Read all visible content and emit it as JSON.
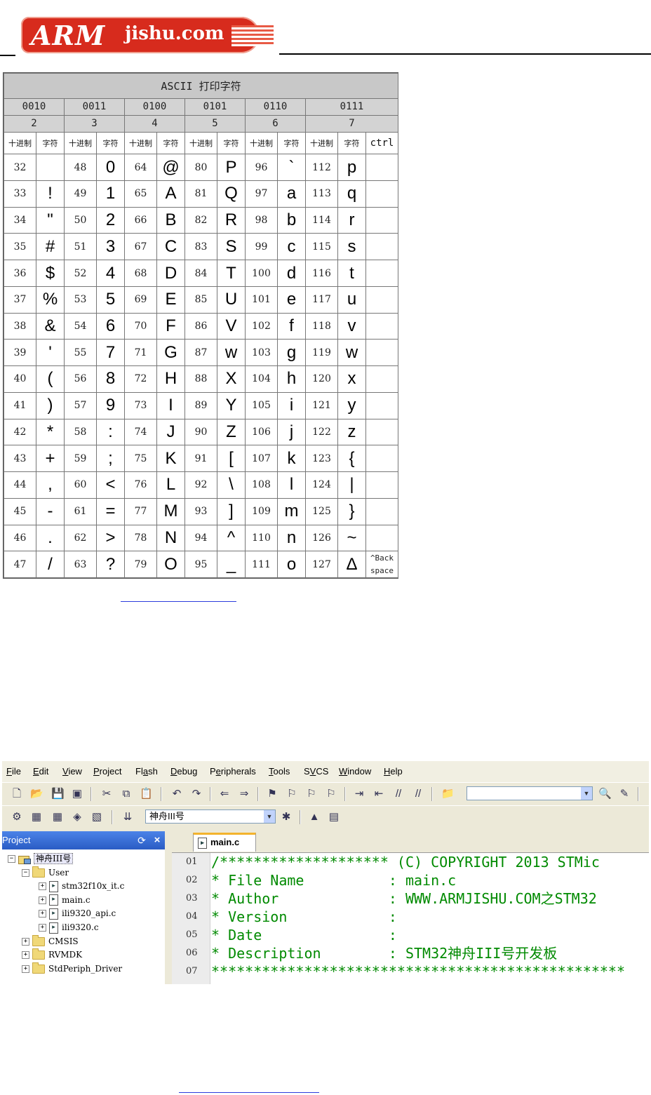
{
  "header": {
    "logo_main": "ARM",
    "logo_site": "jishu.com"
  },
  "ascii_table": {
    "title": "ASCII 打印字符",
    "binary_groups": [
      "0010",
      "0011",
      "0100",
      "0101",
      "0110",
      "0111"
    ],
    "hex_groups": [
      "2",
      "3",
      "4",
      "5",
      "6",
      "7"
    ],
    "col_dec_label": "十进制",
    "col_char_label": "字符",
    "ctrl_label": "ctrl",
    "rows": [
      {
        "d": [
          32,
          48,
          64,
          80,
          96,
          112
        ],
        "c": [
          " ",
          "0",
          "@",
          "P",
          "`",
          "p"
        ],
        "ctrl": ""
      },
      {
        "d": [
          33,
          49,
          65,
          81,
          97,
          113
        ],
        "c": [
          "!",
          "1",
          "A",
          "Q",
          "a",
          "q"
        ],
        "ctrl": ""
      },
      {
        "d": [
          34,
          50,
          66,
          82,
          98,
          114
        ],
        "c": [
          "\"",
          "2",
          "B",
          "R",
          "b",
          "r"
        ],
        "ctrl": ""
      },
      {
        "d": [
          35,
          51,
          67,
          83,
          99,
          115
        ],
        "c": [
          "#",
          "3",
          "C",
          "S",
          "c",
          "s"
        ],
        "ctrl": ""
      },
      {
        "d": [
          36,
          52,
          68,
          84,
          100,
          116
        ],
        "c": [
          "$",
          "4",
          "D",
          "T",
          "d",
          "t"
        ],
        "ctrl": ""
      },
      {
        "d": [
          37,
          53,
          69,
          85,
          101,
          117
        ],
        "c": [
          "%",
          "5",
          "E",
          "U",
          "e",
          "u"
        ],
        "ctrl": ""
      },
      {
        "d": [
          38,
          54,
          70,
          86,
          102,
          118
        ],
        "c": [
          "&",
          "6",
          "F",
          "V",
          "f",
          "v"
        ],
        "ctrl": ""
      },
      {
        "d": [
          39,
          55,
          71,
          87,
          103,
          119
        ],
        "c": [
          "'",
          "7",
          "G",
          "w",
          "g",
          "w"
        ],
        "ctrl": ""
      },
      {
        "d": [
          40,
          56,
          72,
          88,
          104,
          120
        ],
        "c": [
          "(",
          "8",
          "H",
          "X",
          "h",
          "x"
        ],
        "ctrl": ""
      },
      {
        "d": [
          41,
          57,
          73,
          89,
          105,
          121
        ],
        "c": [
          ")",
          "9",
          "I",
          "Y",
          "i",
          "y"
        ],
        "ctrl": ""
      },
      {
        "d": [
          42,
          58,
          74,
          90,
          106,
          122
        ],
        "c": [
          "*",
          ":",
          "J",
          "Z",
          "j",
          "z"
        ],
        "ctrl": ""
      },
      {
        "d": [
          43,
          59,
          75,
          91,
          107,
          123
        ],
        "c": [
          "+",
          ";",
          "K",
          "[",
          "k",
          "{"
        ],
        "ctrl": ""
      },
      {
        "d": [
          44,
          60,
          76,
          92,
          108,
          124
        ],
        "c": [
          ",",
          "<",
          "L",
          "\\",
          "l",
          "|"
        ],
        "ctrl": ""
      },
      {
        "d": [
          45,
          61,
          77,
          93,
          109,
          125
        ],
        "c": [
          "-",
          "=",
          "M",
          "]",
          "m",
          "}"
        ],
        "ctrl": ""
      },
      {
        "d": [
          46,
          62,
          78,
          94,
          110,
          126
        ],
        "c": [
          ".",
          ">",
          "N",
          "^",
          "n",
          "~"
        ],
        "ctrl": ""
      },
      {
        "d": [
          47,
          63,
          79,
          95,
          111,
          127
        ],
        "c": [
          "/",
          "?",
          "O",
          "_",
          "o",
          "Δ"
        ],
        "ctrl": "^Back space"
      }
    ]
  },
  "ide": {
    "menu": [
      {
        "label": "File",
        "u": 0
      },
      {
        "label": "Edit",
        "u": 0
      },
      {
        "label": "View",
        "u": 0
      },
      {
        "label": "Project",
        "u": 0
      },
      {
        "label": "Flash",
        "u": 2
      },
      {
        "label": "Debug",
        "u": 0
      },
      {
        "label": "Peripherals",
        "u": 1
      },
      {
        "label": "Tools",
        "u": 0
      },
      {
        "label": "SVCS",
        "u": 1
      },
      {
        "label": "Window",
        "u": 0
      },
      {
        "label": "Help",
        "u": 0
      }
    ],
    "target_combo": "神舟III号",
    "find_combo": "",
    "project_panel": {
      "title": "Project",
      "tree": [
        {
          "label": "神舟III号",
          "kind": "project",
          "level": 0,
          "expanded": true
        },
        {
          "label": "User",
          "kind": "folder",
          "level": 1,
          "expanded": true
        },
        {
          "label": "stm32f10x_it.c",
          "kind": "file",
          "level": 2
        },
        {
          "label": "main.c",
          "kind": "file",
          "level": 2
        },
        {
          "label": "ili9320_api.c",
          "kind": "file",
          "level": 2
        },
        {
          "label": "ili9320.c",
          "kind": "file",
          "level": 2
        },
        {
          "label": "CMSIS",
          "kind": "folder",
          "level": 1,
          "expanded": false
        },
        {
          "label": "RVMDK",
          "kind": "folder",
          "level": 1,
          "expanded": false
        },
        {
          "label": "StdPeriph_Driver",
          "kind": "folder",
          "level": 1,
          "expanded": false
        }
      ]
    },
    "editor": {
      "tab": "main.c",
      "lines": [
        {
          "n": "01",
          "text": "/******************** (C) COPYRIGHT 2013 STMic"
        },
        {
          "n": "02",
          "text": "* File Name          : main.c"
        },
        {
          "n": "03",
          "text": "* Author             : WWW.ARMJISHU.COM之STM32"
        },
        {
          "n": "04",
          "text": "* Version            :"
        },
        {
          "n": "05",
          "text": "* Date               :"
        },
        {
          "n": "06",
          "text": "* Description        : STM32神舟III号开发板"
        },
        {
          "n": "07",
          "text": "*************************************************"
        }
      ]
    }
  }
}
